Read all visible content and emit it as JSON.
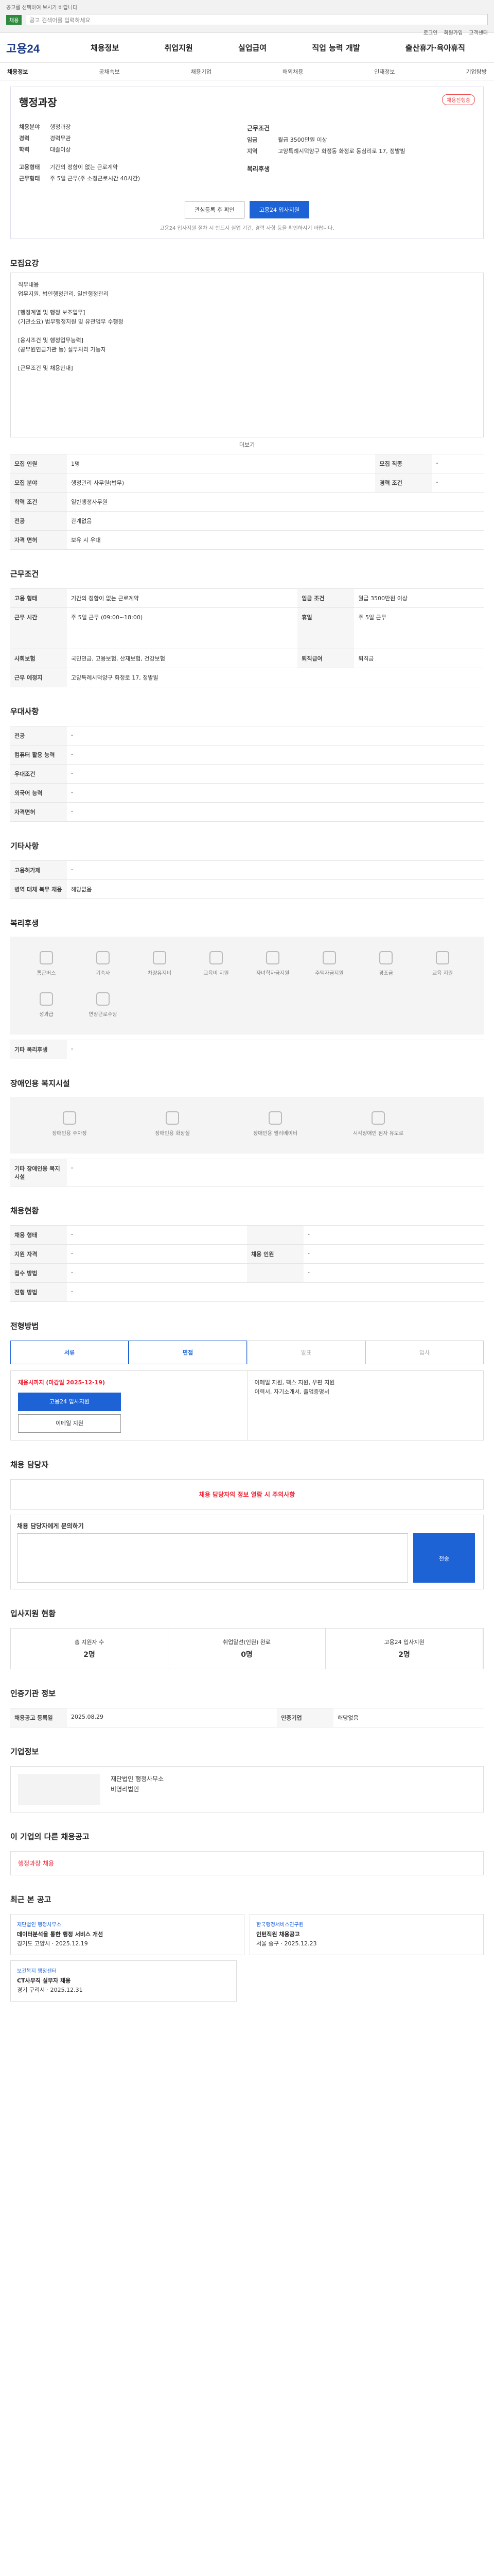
{
  "top": {
    "notice": "공고를 선택하여 보시기 바랍니다",
    "badge": "채용",
    "search": "공고 검색어를 입력하세요",
    "links": [
      "로그인",
      "회원가입",
      "고객센터"
    ]
  },
  "nav": {
    "logo": "고용24",
    "menu": [
      "채용정보",
      "취업지원",
      "실업급여",
      "직업 능력 개발",
      "출산휴가·육아휴직"
    ]
  },
  "subnav": [
    "채용정보",
    "공채속보",
    "채용기업",
    "해외채용",
    "인재정보",
    "기업탐방"
  ],
  "job": {
    "category": "행정과장",
    "tag": "채용진행중",
    "left": [
      [
        "채용분야",
        "행정과장"
      ],
      [
        "경력",
        "경력무관"
      ],
      [
        "학력",
        "대졸이상"
      ],
      [
        "고용형태",
        "기간의 정함이 없는 근로계약"
      ],
      [
        "근무형태",
        "주 5일 근무(주 소정근로시간 40시간)"
      ]
    ],
    "right_head": "근무조건",
    "right": [
      [
        "임금",
        "월급 3500만원 이상"
      ],
      [
        "지역",
        "고양특례시덕양구 화정동 화정로 동심리로 17, 정발빌"
      ]
    ],
    "right_head2": "복리후생",
    "btn_interest": "관심등록 후 확인",
    "btn_apply": "고용24 입사지원",
    "note": "고용24 입사지원 절차 시 반드시 실업 기간, 경력 사항 등을 확인하시기 바랍니다."
  },
  "recruit": {
    "title": "모집요강",
    "body": "직무내용\n업무지원, 법인행정관리, 일반행정관리\n\n[행정계열 및 행정 보조업무]\n(기관소요) 법무행정지원 및 유관업무 수행정\n\n[응시조건 및 행정업무능력]\n(공무원연금기관 등) 실무처리 가능자\n\n[근무조건 및 채용안내]",
    "more": "더보기",
    "rows": [
      [
        "모집 인원",
        "1명",
        "모집 직종",
        "-"
      ],
      [
        "모집 분야",
        "행정관리 사무원(법무)",
        "경력 조건",
        "-"
      ],
      [
        "학력 조건",
        "일반행정사무원",
        "",
        ""
      ],
      [
        "전공",
        "관계없음",
        "",
        ""
      ],
      [
        "자격 면허",
        "보유 시 우대",
        "",
        ""
      ]
    ]
  },
  "cond": {
    "title": "근무조건",
    "rows": [
      [
        "고용 형태",
        "기간의 정함이 없는 근로계약",
        "임금 조건",
        "월급 3500만원 이상"
      ],
      [
        "근무 시간",
        "주 5일 근무 (09:00~18:00)",
        "휴일",
        "주 5일 근무"
      ],
      [
        "사회보험",
        "국민연금, 고용보험, 산재보험, 건강보험",
        "퇴직급여",
        "퇴직금"
      ],
      [
        "근무 예정지",
        "고양특례시덕양구 화정로 17, 정발빌",
        "",
        ""
      ]
    ]
  },
  "pref": {
    "title": "우대사항",
    "rows": [
      [
        "전공",
        "-"
      ],
      [
        "컴퓨터 활용 능력",
        "-"
      ],
      [
        "우대조건",
        "-"
      ],
      [
        "외국어 능력",
        "-"
      ],
      [
        "자격면허",
        "-"
      ]
    ]
  },
  "etc": {
    "title": "기타사항",
    "rows": [
      [
        "고용허가제",
        "-"
      ],
      [
        "병역 대체 복무 채용",
        "해당없음"
      ]
    ]
  },
  "welfare": {
    "title": "복리후생",
    "items": [
      "통근버스",
      "기숙사",
      "차량유지비",
      "교육비 지원",
      "자녀학자금지원",
      "주택자금지원",
      "경조금",
      "교육 지원",
      "성과급",
      "연장근로수당"
    ],
    "note": "기타 복리후생"
  },
  "disabled": {
    "title": "장애인용 복지시설",
    "items": [
      "장애인용 주차장",
      "장애인용 화장실",
      "장애인용 엘리베이터",
      "시각장애인 점자 유도로"
    ],
    "note": "기타 장애인용 복지시설"
  },
  "quota": {
    "title": "채용현황",
    "rows": [
      [
        "채용 형태",
        "-",
        "",
        "-"
      ],
      [
        "지원 자격",
        "-",
        "채용 인원",
        "-"
      ],
      [
        "접수 방법",
        "-",
        "",
        "-"
      ],
      [
        "전형 방법",
        "-",
        "",
        ""
      ]
    ]
  },
  "process": {
    "title": "전형방법",
    "steps": [
      "서류",
      "면접",
      "발표",
      "입사"
    ]
  },
  "apply": {
    "deadline": "채용시까지 (마감일 2025-12-19)",
    "applybtn": "고용24 입사지원",
    "emailbtn": "이메일 지원",
    "method": "이메일 지원, 팩스 지원, 우편 지원",
    "docs": "이력서, 자기소개서, 졸업증명서"
  },
  "contact": {
    "title": "채용 담당자",
    "alert": "채용 담당자의 정보 열람 시 주의사항",
    "ask": "채용 담당자에게 문의하기"
  },
  "stats": {
    "title": "입사지원 현황",
    "items": [
      [
        "총 지원자 수",
        "2명"
      ],
      [
        "취업알선(인원) 완료",
        "0명"
      ],
      [
        "고용24 입사지원",
        "2명"
      ]
    ]
  },
  "info": {
    "title": "인증기관 정보",
    "rows": [
      [
        "채용공고 등록일",
        "2025.08.29",
        "인증기업",
        "해당없음"
      ]
    ]
  },
  "corp": {
    "title": "기업정보",
    "name": "재단법인 행정사무소",
    "type": "비영리법인"
  },
  "others": {
    "title": "이 기업의 다른 채용공고",
    "item": "행정과장 채용"
  },
  "recent": {
    "title": "최근 본 공고",
    "cards": [
      [
        "재단법인 행정사무소",
        "데이터분석을 통한 행정 서비스 개선",
        "경기도 고양시 · 2025.12.19"
      ],
      [
        "한국행정서비스연구원",
        "인턴직원 채용공고",
        "서울 중구 · 2025.12.23"
      ],
      [
        "보건복지 행정센터",
        "CT사무직 실무자 채용",
        "경기 구리시 · 2025.12.31"
      ]
    ]
  }
}
